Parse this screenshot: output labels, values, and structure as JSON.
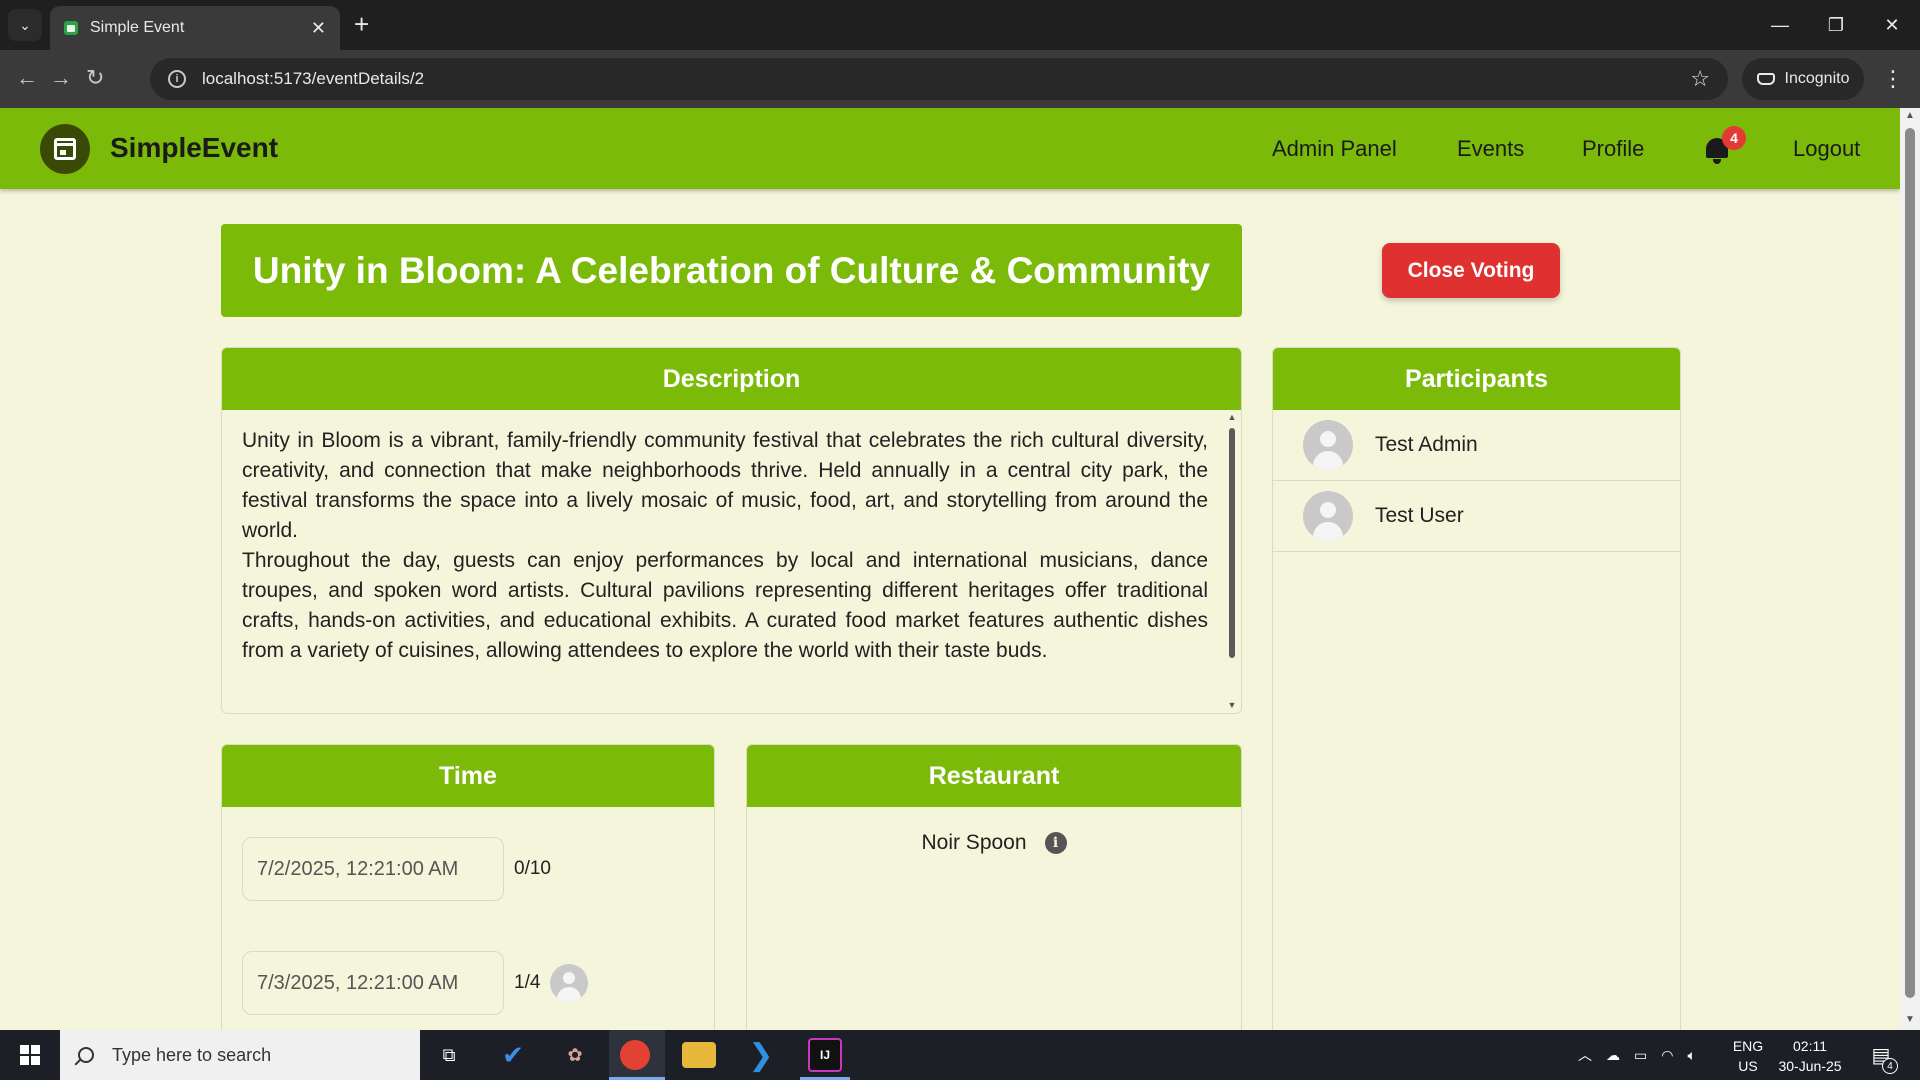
{
  "browser": {
    "tab_title": "Simple Event",
    "url": "localhost:5173/eventDetails/2",
    "incognito_label": "Incognito"
  },
  "navbar": {
    "brand": "SimpleEvent",
    "links": [
      "Admin Panel",
      "Events",
      "Profile"
    ],
    "notification_count": "4",
    "logout": "Logout",
    "color": "#7cba0a"
  },
  "event": {
    "title": "Unity in Bloom: A Celebration of Culture & Community",
    "close_voting_label": "Close Voting",
    "description_header": "Description",
    "description_p1": "Unity in Bloom is a vibrant, family-friendly community festival that celebrates the rich cultural diversity, creativity, and connection that make neighborhoods thrive. Held annually in a central city park, the festival transforms the space into a lively mosaic of music, food, art, and storytelling from around the world.",
    "description_p2": "Throughout the day, guests can enjoy performances by local and international musicians, dance troupes, and spoken word artists. Cultural pavilions representing different heritages offer traditional crafts, hands-on activities, and educational exhibits. A curated food market features authentic dishes from a variety of cuisines, allowing attendees to explore the world with their taste buds."
  },
  "participants": {
    "header": "Participants",
    "list": [
      "Test Admin",
      "Test User"
    ]
  },
  "time": {
    "header": "Time",
    "options": [
      {
        "value": "7/2/2025, 12:21:00 AM",
        "count": "0/10"
      },
      {
        "value": "7/3/2025, 12:21:00 AM",
        "count": "1/4"
      }
    ]
  },
  "restaurant": {
    "header": "Restaurant",
    "name": "Noir Spoon"
  },
  "taskbar": {
    "search_placeholder": "Type here to search",
    "lang_line1": "ENG",
    "lang_line2": "US",
    "time": "02:11",
    "date": "30-Jun-25",
    "notification_count": "4"
  },
  "colors": {
    "accent": "#7cba0a",
    "danger": "#e03131",
    "page_bg": "#f5f5dc"
  }
}
